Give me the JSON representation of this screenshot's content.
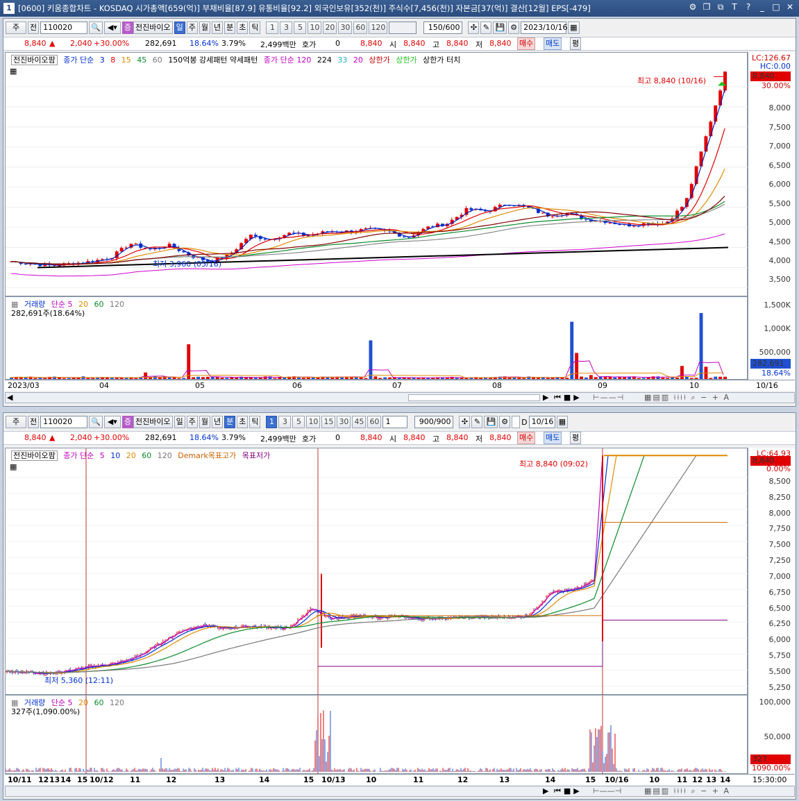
{
  "window": {
    "index": "1",
    "title": "[0600] 키움종합차트 - KOSDAQ 시가총액[659(억)] 부채비율[87.9] 유통비율[92.2] 외국인보유[352(천)] 주식수[7,456(천)] 자본금[37(억)] 결산[12월] EPS[-479]"
  },
  "top_pane": {
    "toolbar": {
      "type_select": "주",
      "prev": "전",
      "code": "110020",
      "name": "전진바이오",
      "name_badge": "증",
      "periods": [
        "일",
        "주",
        "월",
        "년",
        "분",
        "초",
        "틱"
      ],
      "selected_period": "일",
      "intervals": [
        "1",
        "3",
        "5",
        "10",
        "20",
        "30",
        "60",
        "120"
      ],
      "count": "150",
      "count_total": "/600",
      "date": "2023/10/16"
    },
    "quote": {
      "price": "8,840",
      "change": "2,040",
      "rate": "+30.00%",
      "volume": "282,691",
      "turnover": "18.64%",
      "ratio": "3.79%",
      "amount": "2,499백만",
      "hoga_label": "호가",
      "hoga_value": "0",
      "hoga_price": "8,840",
      "open_label": "시",
      "open": "8,840",
      "high_label": "고",
      "high": "8,840",
      "low_label": "저",
      "low": "8,840",
      "buy": "매수",
      "sell": "매도",
      "avg": "평"
    },
    "legend": {
      "stock": "전진바이오팜",
      "ma_label": "종가 단순",
      "ma_periods": [
        "3",
        "8",
        "15",
        "45",
        "60"
      ],
      "candle_label": "150억봉 강세패턴  약세패턴",
      "ma2_label": "종가 단순 120",
      "ma2_periods": [
        "224",
        "33",
        "20"
      ],
      "upper": "상한가",
      "upper2": "상한가",
      "touch": "상한가 터치"
    },
    "annotations": {
      "high": "최고 8,840 (10/16)",
      "low": "최저 3,960 (05/16)"
    },
    "price_axis": [
      "LC:126.67",
      "HC:0.00",
      "8,840",
      "30.00%",
      "8,000",
      "7,500",
      "7,000",
      "6,500",
      "6,000",
      "5,500",
      "5,000",
      "4,500",
      "4,000",
      "3,500"
    ],
    "volume_legend": {
      "label": "거래량",
      "ma": "단순 5",
      "p20": "20",
      "p60": "60",
      "p120": "120",
      "value": "282,691주(18.64%)"
    },
    "volume_axis": [
      "1,500K",
      "1,000K",
      "500,000",
      "282,691",
      "18.64%"
    ],
    "x_labels": [
      "2023/03",
      "04",
      "05",
      "06",
      "07",
      "08",
      "09",
      "10",
      "10/16"
    ],
    "chart_data": {
      "type": "candlestick",
      "x_months": [
        "2023/03",
        "04",
        "05",
        "06",
        "07",
        "08",
        "09",
        "10"
      ],
      "ylim": [
        3300,
        9000
      ],
      "close_path": [
        4150,
        4100,
        4050,
        4100,
        4150,
        4250,
        4600,
        4450,
        4550,
        4300,
        4150,
        4300,
        4800,
        4700,
        4850,
        4800,
        4900,
        4900,
        4950,
        4900,
        4750,
        5000,
        5100,
        5450,
        5400,
        5600,
        5500,
        5300,
        5350,
        5200,
        5150,
        5050,
        5100,
        5100,
        5600,
        7200,
        8840
      ],
      "volume_series": [
        120,
        80,
        90,
        60,
        200,
        800,
        60,
        90,
        40,
        60,
        70,
        890,
        60,
        80,
        70,
        50,
        60,
        1320,
        600,
        150,
        60,
        80,
        90,
        70,
        60,
        50,
        90,
        1520,
        282
      ],
      "high": 8840,
      "low": 3960
    }
  },
  "bottom_pane": {
    "toolbar": {
      "type_select": "주",
      "prev": "전",
      "code": "110020",
      "name": "전진바이오",
      "name_badge": "증",
      "periods": [
        "일",
        "주",
        "월",
        "년",
        "분",
        "초",
        "틱"
      ],
      "selected_period": "분",
      "intervals": [
        "1",
        "3",
        "5",
        "10",
        "15",
        "30",
        "45",
        "60"
      ],
      "selected_interval": "1",
      "unit": "1",
      "count": "900",
      "count_total": "/900",
      "date": "10/16",
      "check_label": "D"
    },
    "quote": {
      "price": "8,840",
      "change": "2,040",
      "rate": "+30.00%",
      "volume": "282,691",
      "turnover": "18.64%",
      "ratio": "3.79%",
      "amount": "2,499백만",
      "hoga_label": "호가",
      "hoga_value": "0",
      "hoga_price": "8,840",
      "open_label": "시",
      "open": "8,840",
      "high_label": "고",
      "high": "8,840",
      "low_label": "저",
      "low": "8,840",
      "buy": "매수",
      "sell": "매도",
      "avg": "평"
    },
    "legend": {
      "stock": "전진바이오팜",
      "ma_label": "종가 단순",
      "ma_periods": [
        "5",
        "10",
        "20",
        "60",
        "120"
      ],
      "demark_high": "Demark목표고가",
      "demark_low": "목표저가"
    },
    "annotations": {
      "high": "최고 8,840 (09:02)",
      "low": "최저 5,360 (12:11)"
    },
    "price_axis": [
      "LC:64.93",
      "8,840",
      "0.00%",
      "8,500",
      "8,250",
      "8,000",
      "7,750",
      "7,500",
      "7,250",
      "7,000",
      "6,750",
      "6,500",
      "6,250",
      "6,000",
      "5,750",
      "5,500",
      "5,250"
    ],
    "volume_legend": {
      "label": "거래량",
      "ma": "단순 5",
      "p20": "20",
      "p60": "60",
      "p120": "120",
      "value": "327주(1,090.00%)"
    },
    "volume_axis": [
      "100,000",
      "50,000",
      "327",
      "1090.00%"
    ],
    "x_labels": [
      "10/11",
      "12",
      "13",
      "14",
      "15",
      "10/12",
      "11",
      "12",
      "13",
      "14",
      "15",
      "10/13",
      "10",
      "11",
      "12",
      "13",
      "14",
      "15",
      "10/16",
      "10",
      "11",
      "12",
      "13",
      "14"
    ],
    "time_label": "15:30:00",
    "chart_data": {
      "type": "candlestick",
      "ylim": [
        5150,
        8950
      ],
      "close_path": [
        5480,
        5470,
        5450,
        5500,
        5560,
        5600,
        5700,
        5900,
        6100,
        6200,
        6150,
        6180,
        6170,
        6150,
        6450,
        6300,
        6350,
        6320,
        6340,
        6300,
        6310,
        6320,
        6330,
        6320,
        6350,
        6700,
        6750,
        6900,
        8840
      ],
      "demark_high": 7800,
      "demark_low": 6280,
      "high": 8840,
      "low": 5360
    }
  }
}
